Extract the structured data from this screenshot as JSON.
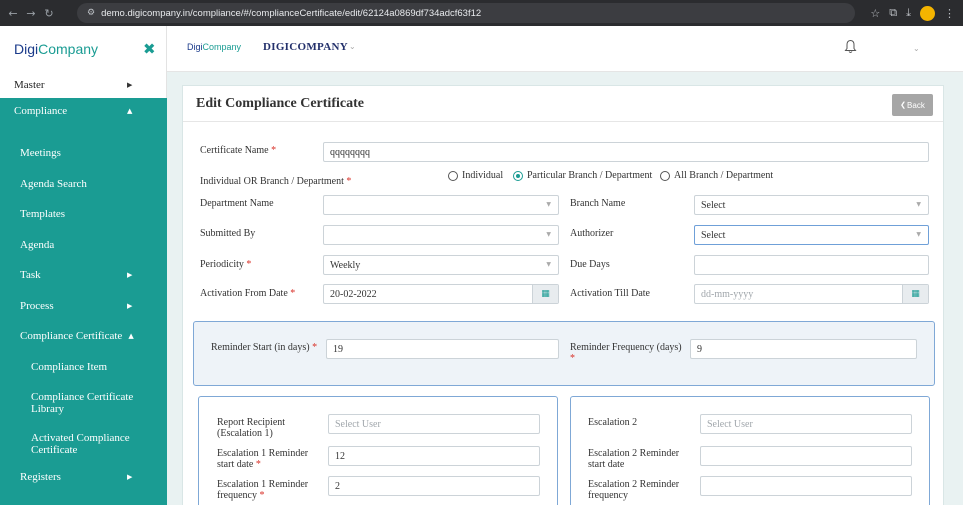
{
  "browser": {
    "url": "demo.digicompany.in/compliance/#/complianceCertificate/edit/62124a0869df734adcf63f12"
  },
  "sidebar": {
    "brand": {
      "part1": "Digi",
      "part2": "Company"
    },
    "items": [
      {
        "label": "Master"
      },
      {
        "label": "Compliance"
      },
      {
        "label": "Meetings"
      },
      {
        "label": "Agenda Search"
      },
      {
        "label": "Templates"
      },
      {
        "label": "Agenda"
      },
      {
        "label": "Task"
      },
      {
        "label": "Process"
      },
      {
        "label": "Compliance Certificate"
      },
      {
        "label": "Compliance Item"
      },
      {
        "label": "Compliance Certificate Library"
      },
      {
        "label": "Activated Compliance Certificate"
      },
      {
        "label": "Registers"
      }
    ]
  },
  "header": {
    "logo": {
      "part1": "Digi",
      "part2": "Company"
    },
    "company": "DIGICOMPANY"
  },
  "page": {
    "title": "Edit Compliance Certificate",
    "back_label": "Back"
  },
  "form": {
    "certificate_name": {
      "label": "Certificate Name",
      "value": "qqqqqqqq"
    },
    "individual_or_branch": {
      "label": "Individual OR Branch / Department",
      "options": [
        "Individual",
        "Particular Branch / Department",
        "All Branch / Department"
      ],
      "selected": "Particular Branch / Department"
    },
    "department_name": {
      "label": "Department Name",
      "value": ""
    },
    "branch_name": {
      "label": "Branch Name",
      "value": "Select"
    },
    "submitted_by": {
      "label": "Submitted By",
      "value": ""
    },
    "authorizer": {
      "label": "Authorizer",
      "value": "Select"
    },
    "periodicity": {
      "label": "Periodicity",
      "value": "Weekly"
    },
    "due_days": {
      "label": "Due Days",
      "value": ""
    },
    "activation_from": {
      "label": "Activation From Date",
      "value": "20-02-2022"
    },
    "activation_till": {
      "label": "Activation Till Date",
      "placeholder": "dd-mm-yyyy"
    },
    "reminder_start": {
      "label": "Reminder Start (in days)",
      "value": "19"
    },
    "reminder_frequency": {
      "label": "Reminder Frequency (days)",
      "value": "9"
    },
    "report_recipient": {
      "label": "Report Recipient (Escalation 1)",
      "placeholder": "Select User"
    },
    "escalation1_start": {
      "label": "Escalation 1 Reminder start date",
      "value": "12"
    },
    "escalation1_frequency": {
      "label": "Escalation 1 Reminder frequency",
      "value": "2"
    },
    "escalation2": {
      "label": "Escalation 2",
      "placeholder": "Select User"
    },
    "escalation2_start": {
      "label": "Escalation 2 Reminder start date",
      "value": ""
    },
    "escalation2_frequency": {
      "label": "Escalation 2 Reminder frequency",
      "value": ""
    }
  },
  "colors": {
    "teal": "#1a9c93",
    "navy": "#23306b",
    "required": "#d9332b"
  }
}
